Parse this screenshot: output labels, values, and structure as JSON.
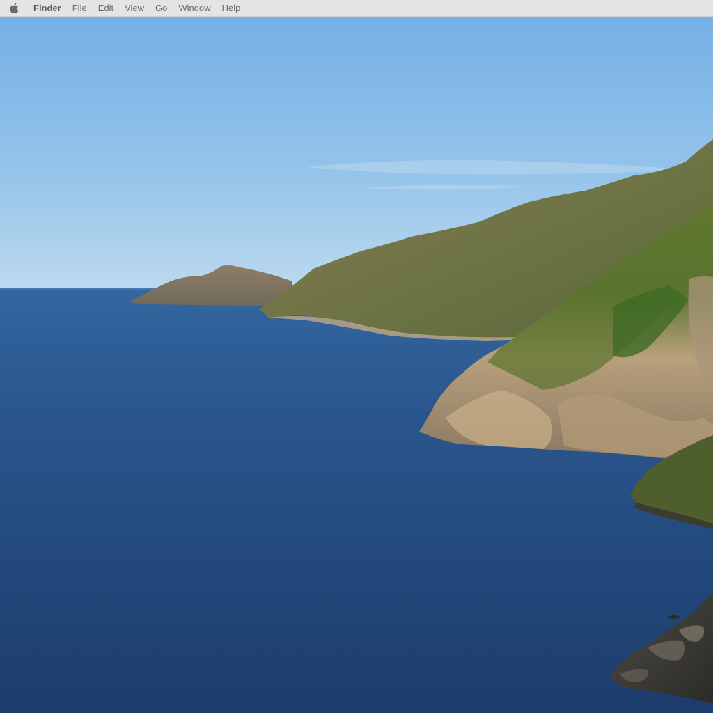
{
  "menubar": {
    "apple_icon": "apple-logo-icon",
    "app_name": "Finder",
    "items": [
      {
        "label": "File"
      },
      {
        "label": "Edit"
      },
      {
        "label": "View"
      },
      {
        "label": "Go"
      },
      {
        "label": "Window"
      },
      {
        "label": "Help"
      }
    ]
  },
  "desktop": {
    "wallpaper": "coastal-cliffs-ocean-landscape",
    "colors": {
      "sky_top": "#7ab4e8",
      "sky_horizon": "#bcd9ee",
      "ocean_far": "#2e5f96",
      "ocean_near": "#1d3e6c",
      "cliff_green": "#6a7a3e",
      "cliff_rock": "#b49a74"
    }
  }
}
